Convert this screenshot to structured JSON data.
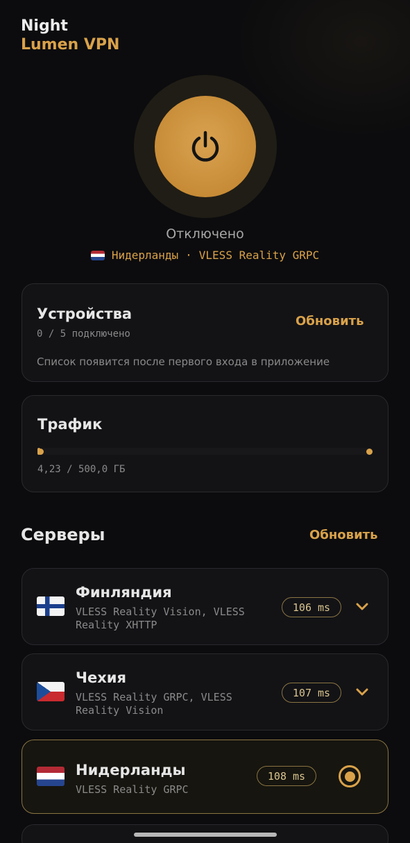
{
  "app": {
    "brand_line1": "Night",
    "brand_line2": "Lumen VPN"
  },
  "connection": {
    "status": "Отключено",
    "current_location": "Нидерланды",
    "separator": "·",
    "current_protocol": "VLESS Reality GRPC",
    "power_icon": "power-icon"
  },
  "devices": {
    "title": "Устройства",
    "count_text": "0 / 5 подключено",
    "refresh_label": "Обновить",
    "hint": "Список появится после первого входа в приложение"
  },
  "traffic": {
    "title": "Трафик",
    "usage_text": "4,23 / 500,0 ГБ",
    "used_gb": 4.23,
    "total_gb": 500.0
  },
  "servers": {
    "title": "Серверы",
    "refresh_label": "Обновить",
    "items": [
      {
        "name": "Финляндия",
        "protocols": "VLESS Reality Vision, VLESS Reality XHTTP",
        "ping": "106 ms",
        "flag": "finland-flag",
        "selected": false
      },
      {
        "name": "Чехия",
        "protocols": "VLESS Reality GRPC, VLESS Reality Vision",
        "ping": "107 ms",
        "flag": "czech-flag",
        "selected": false
      },
      {
        "name": "Нидерланды",
        "protocols": "VLESS Reality GRPC",
        "ping": "108 ms",
        "flag": "netherlands-flag",
        "selected": true
      }
    ]
  },
  "colors": {
    "accent": "#d9a24a",
    "background": "#0c0c0e",
    "card": "#131316"
  }
}
